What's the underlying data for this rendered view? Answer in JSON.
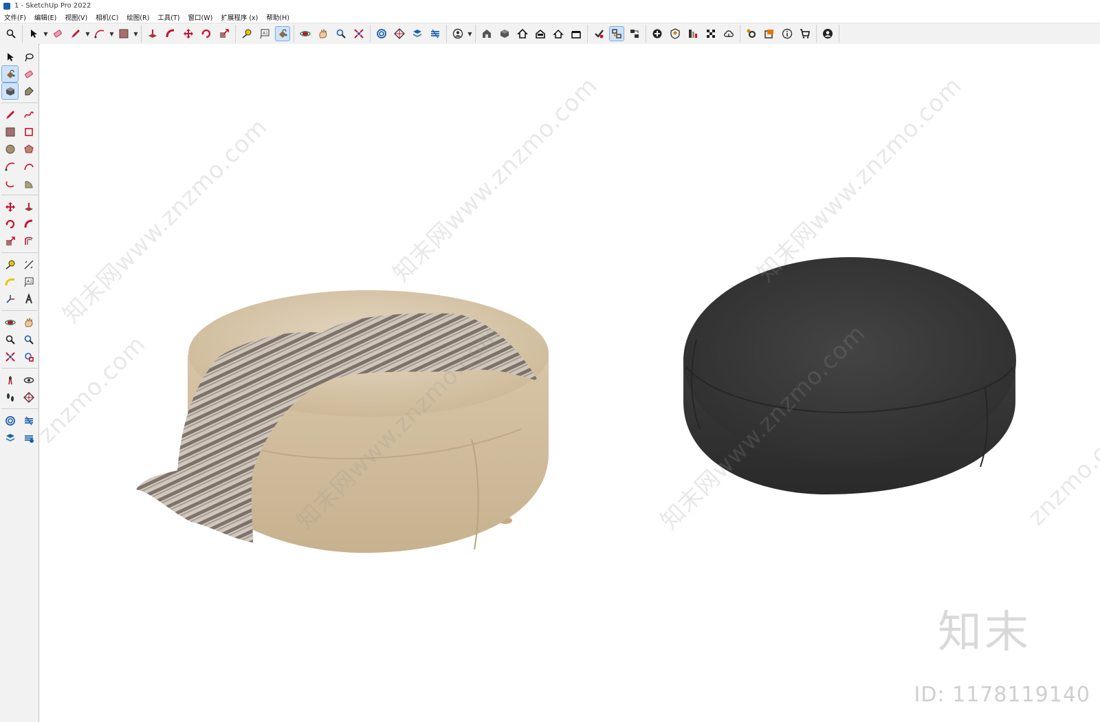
{
  "window": {
    "title": "1 - SketchUp Pro 2022"
  },
  "menu": [
    "文件(F)",
    "编辑(E)",
    "视图(V)",
    "相机(C)",
    "绘图(R)",
    "工具(T)",
    "窗口(W)",
    "扩展程序 (x)",
    "帮助(H)"
  ],
  "toolbar_groups": [
    [
      "zoom-icon"
    ],
    [
      "select-icon",
      "eraser-icon",
      "pencil-line-icon",
      "arc-icon",
      "rectangle-icon"
    ],
    [
      "push-pull-icon",
      "follow-me-icon",
      "move-icon",
      "rotate-icon",
      "scale-icon"
    ],
    [
      "tape-measure-icon",
      "text-icon",
      "paint-bucket-icon"
    ],
    [
      "orbit-icon",
      "pan-icon",
      "zoom-window-icon",
      "zoom-extents-icon"
    ],
    [
      "sandbox-icon",
      "section-plane-icon",
      "layers-icon",
      "styles-icon"
    ],
    [
      "user-icon"
    ],
    [
      "warehouse-icon",
      "component-icon",
      "home-icon",
      "house-open-icon",
      "house-outline-icon",
      "box-icon"
    ],
    [
      "solid-check-icon",
      "outliner-icon",
      "scene-icon"
    ],
    [
      "add-location-icon",
      "shield-icon",
      "layout-icon",
      "checker-icon",
      "cloud-icon"
    ],
    [
      "extension-gear-icon",
      "dialog-icon",
      "info-icon",
      "cart-icon"
    ],
    [
      "account-icon"
    ]
  ],
  "toolbar_active": [
    "paint-bucket-icon",
    "outliner-icon"
  ],
  "left_tools": [
    "select-arrow-icon",
    "lasso-icon",
    "paint-bucket-icon",
    "eraser-icon",
    "component-icon",
    "tag-icon",
    "sep",
    "pencil-icon",
    "freehand-icon",
    "rectangle-icon",
    "rotated-rectangle-icon",
    "circle-icon",
    "polygon-icon",
    "arc-icon",
    "two-point-arc-icon",
    "three-point-arc-icon",
    "pie-icon",
    "sep",
    "move-icon",
    "push-pull-icon",
    "rotate-icon",
    "follow-me-icon",
    "scale-icon",
    "offset-icon",
    "sep",
    "tape-measure-icon",
    "dimension-icon",
    "protractor-icon",
    "text-icon",
    "axes-icon",
    "3d-text-icon",
    "sep",
    "orbit-icon",
    "pan-icon",
    "zoom-icon",
    "zoom-window-icon",
    "zoom-extents-icon",
    "previous-view-icon",
    "sep",
    "position-camera-icon",
    "look-around-icon",
    "walk-icon",
    "section-plane-icon",
    "sep",
    "sandbox-icon",
    "section-fill-icon",
    "layers-icon",
    "drape-icon"
  ],
  "left_active": [
    "paint-bucket-icon",
    "component-icon"
  ],
  "colors": {
    "ottoman_beige": "#d8c6ab",
    "ottoman_dark": "#3a3a3a",
    "throw_light": "#cfc6bd",
    "throw_dark": "#7b6f66",
    "accent_blue": "#2f7fc9",
    "accent_red": "#c8102e"
  },
  "watermark": {
    "text": "知末网www.znzmo.com",
    "short": "znzmo.com"
  },
  "brand": "知末",
  "asset_id": "ID: 1178119140"
}
